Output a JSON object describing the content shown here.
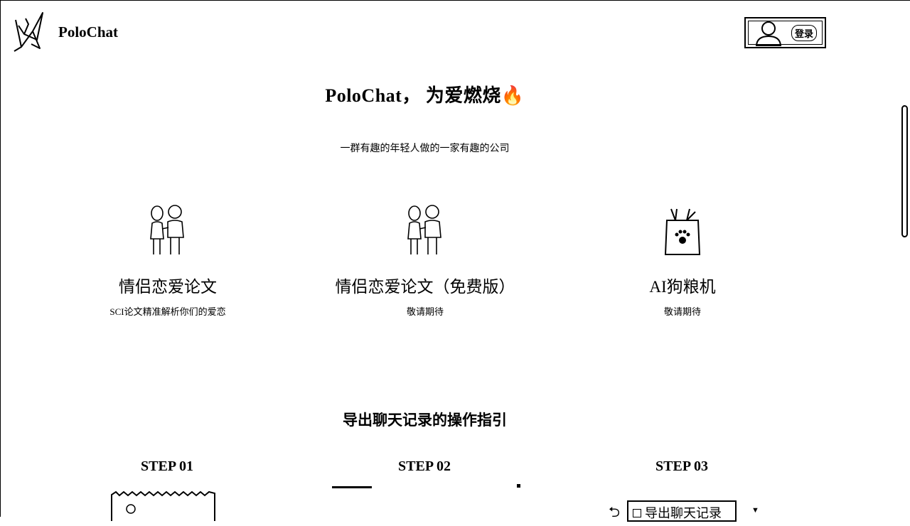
{
  "header": {
    "brand": "PoloChat",
    "login_label": "登录"
  },
  "hero": {
    "title": "PoloChat， 为爱燃烧🔥",
    "subtitle": "一群有趣的年轻人做的一家有趣的公司"
  },
  "products": [
    {
      "title": "情侣恋爱论文",
      "desc": "SCI论文精准解析你们的爱恋",
      "icon": "couple-icon"
    },
    {
      "title": "情侣恋爱论文（免费版）",
      "desc": "敬请期待",
      "icon": "couple-icon"
    },
    {
      "title": "AI狗粮机",
      "desc": "敬请期待",
      "icon": "dog-food-bag-icon"
    }
  ],
  "guide": {
    "title": "导出聊天记录的操作指引",
    "steps": [
      "STEP 01",
      "STEP 02",
      "STEP 03"
    ],
    "step3_button": "导出聊天记录"
  }
}
